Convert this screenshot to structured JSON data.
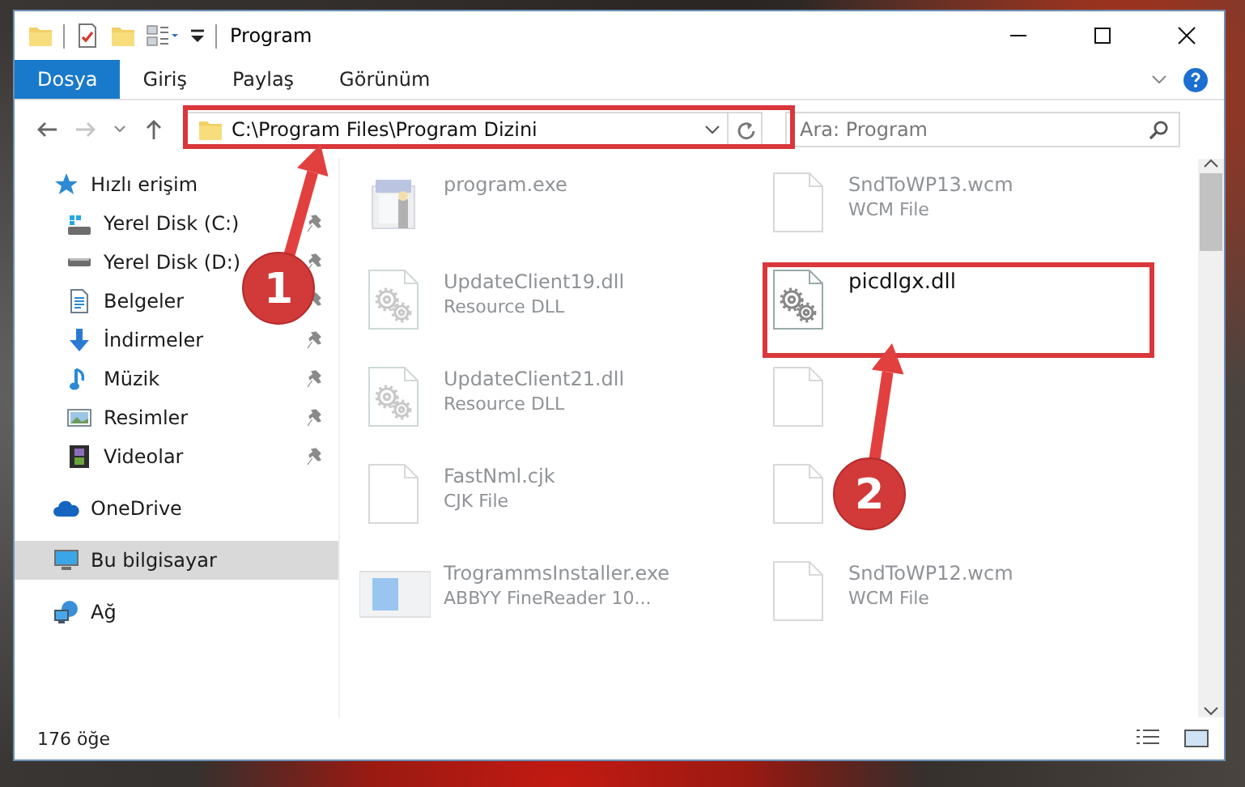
{
  "window": {
    "title": "Program"
  },
  "ribbon_tabs": [
    {
      "label": "Dosya",
      "selected": true
    },
    {
      "label": "Giriş",
      "selected": false
    },
    {
      "label": "Paylaş",
      "selected": false
    },
    {
      "label": "Görünüm",
      "selected": false
    }
  ],
  "address": {
    "path": "C:\\Program Files\\Program Dizini"
  },
  "search": {
    "placeholder": "Ara: Program"
  },
  "sidebar": {
    "items": [
      {
        "label": "Hızlı erişim",
        "selected": false,
        "children": [
          {
            "label": "Yerel Disk (C:)",
            "pinned": true
          },
          {
            "label": "Yerel Disk (D:)",
            "pinned": true
          },
          {
            "label": "Belgeler",
            "pinned": true
          },
          {
            "label": "İndirmeler",
            "pinned": true
          },
          {
            "label": "Müzik",
            "pinned": true
          },
          {
            "label": "Resimler",
            "pinned": true
          },
          {
            "label": "Videolar",
            "pinned": true
          }
        ]
      },
      {
        "label": "OneDrive",
        "selected": false
      },
      {
        "label": "Bu bilgisayar",
        "selected": true
      },
      {
        "label": "Ağ",
        "selected": false
      }
    ]
  },
  "files": [
    {
      "name": "program.exe",
      "kind": "exe",
      "faded": true
    },
    {
      "name": "SndToWP13.wcm",
      "type": "WCM File",
      "kind": "file",
      "faded": true
    },
    {
      "name": "UpdateClient19.dll",
      "type": "Resource DLL",
      "kind": "dll",
      "faded": true
    },
    {
      "name": "picdlgx.dll",
      "kind": "dll",
      "faded": false
    },
    {
      "name": "UpdateClient21.dll",
      "type": "Resource DLL",
      "kind": "dll",
      "faded": true
    },
    {
      "kind": "file",
      "faded": true
    },
    {
      "name": "FastNml.cjk",
      "type": "CJK File",
      "kind": "file",
      "faded": true
    },
    {
      "kind": "file",
      "faded": true
    },
    {
      "name": "TrogrammsInstaller.exe",
      "type": "ABBYY FineReader 10...",
      "kind": "installer",
      "faded": true
    },
    {
      "name": "SndToWP12.wcm",
      "type": "WCM File",
      "kind": "file",
      "faded": true
    }
  ],
  "callouts": [
    {
      "label": "1"
    },
    {
      "label": "2"
    }
  ],
  "status_bar": {
    "item_count": "176 öğe"
  }
}
